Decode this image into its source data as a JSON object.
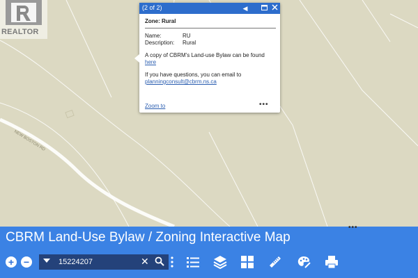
{
  "watermark": {
    "brand": "REALTOR"
  },
  "map": {
    "road_label": "NEW BOSTON RD",
    "colors": {
      "background": "#dcd9c2",
      "lines": "#ffffff"
    }
  },
  "popup": {
    "pager": "(2 of 2)",
    "title": "Zone: Rural",
    "name_label": "Name:",
    "name_value": "RU",
    "description_label": "Description:",
    "description_value": "Rural",
    "bylaw_text": "A copy of CBRM's Land-use Bylaw can be found",
    "bylaw_link": "here",
    "contact_text": "If you have questions, you can email to",
    "contact_email": "planningconsult@cbrm.ns.ca",
    "zoom_label": "Zoom to",
    "more_label": "•••",
    "icons": [
      "previous-arrow-icon",
      "maximize-icon",
      "close-icon"
    ],
    "header_color": "#2d6dcc"
  },
  "panel": {
    "title": "CBRM Land-Use Bylaw / Zoning Interactive Map",
    "handle": "•••",
    "zoom_in_label": "+",
    "zoom_out_label": "−",
    "search_value": "15224207",
    "search_clear": "✕",
    "tools": [
      "legend-list-icon",
      "layers-icon",
      "basemap-gallery-icon",
      "measure-ruler-icon",
      "draw-palette-icon",
      "print-icon"
    ],
    "color": "#3b82e4"
  }
}
